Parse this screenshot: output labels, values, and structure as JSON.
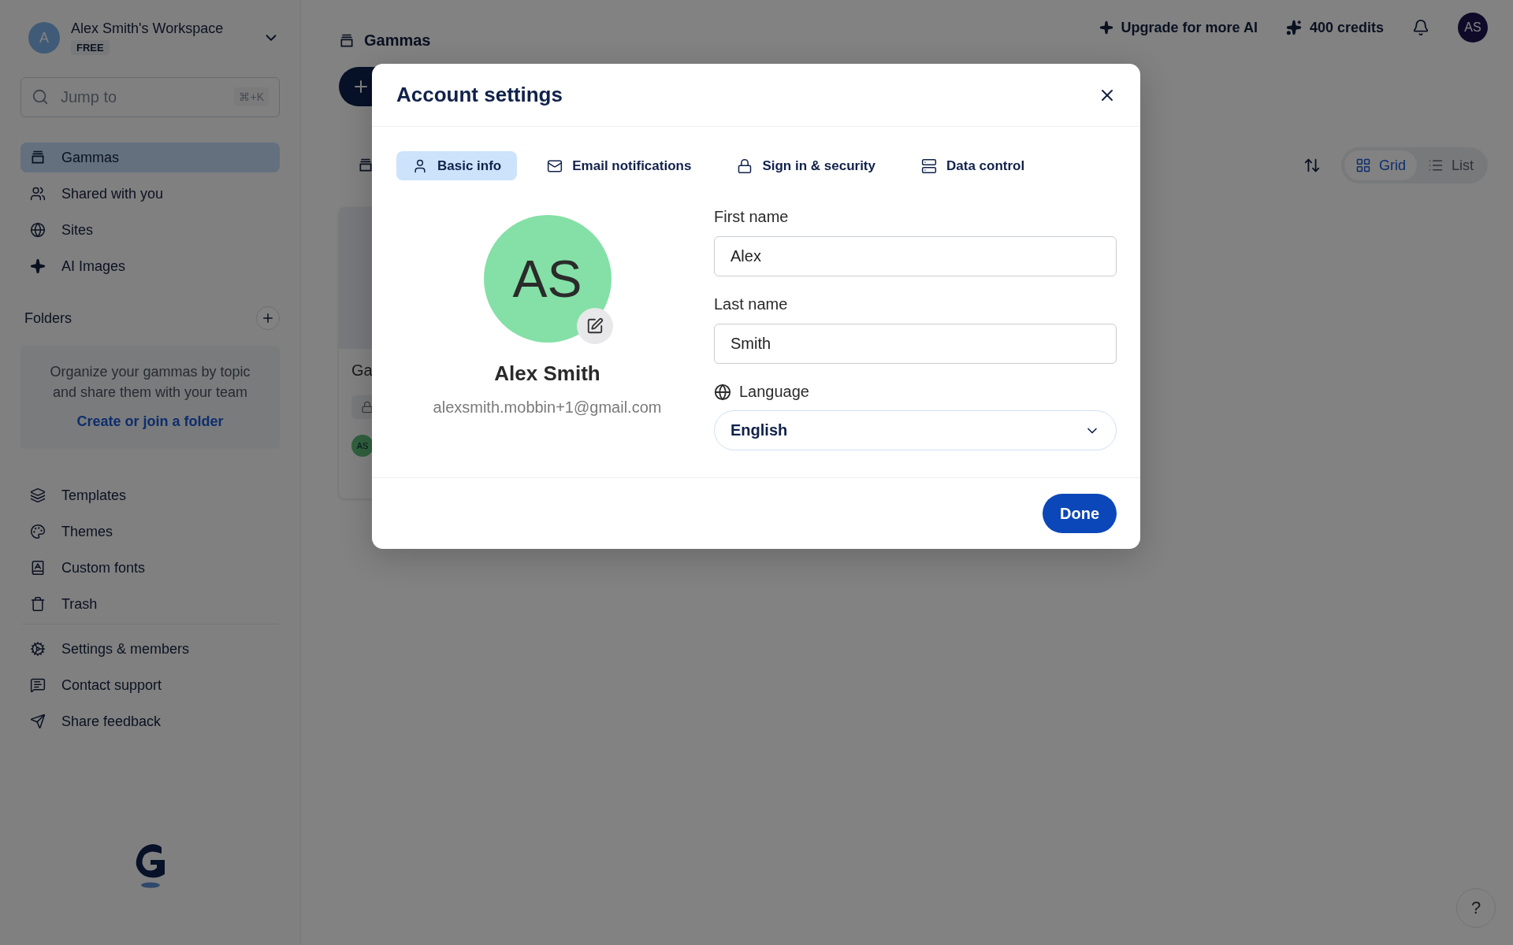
{
  "workspace": {
    "avatar": "A",
    "name": "Alex Smith's Workspace",
    "plan": "FREE"
  },
  "search": {
    "placeholder": "Jump to",
    "shortcut": "⌘+K"
  },
  "nav": [
    {
      "label": "Gammas",
      "selected": true
    },
    {
      "label": "Shared with you",
      "selected": false
    },
    {
      "label": "Sites",
      "selected": false
    },
    {
      "label": "AI Images",
      "selected": false
    }
  ],
  "folders": {
    "title": "Folders",
    "empty_text": "Organize your gammas by topic and share them with your team",
    "link": "Create or join a folder"
  },
  "tools": [
    {
      "label": "Templates"
    },
    {
      "label": "Themes"
    },
    {
      "label": "Custom fonts"
    },
    {
      "label": "Trash"
    }
  ],
  "support": [
    {
      "label": "Settings & members"
    },
    {
      "label": "Contact support"
    },
    {
      "label": "Share feedback"
    }
  ],
  "header": {
    "title": "Gammas",
    "upgrade": "Upgrade for more AI",
    "credits": "400 credits",
    "avatar": "AS"
  },
  "view_toggle": [
    {
      "label": "Grid",
      "selected": true
    },
    {
      "label": "List",
      "selected": false
    }
  ],
  "card": {
    "title": "Ga",
    "owner": "AS"
  },
  "dialog": {
    "title": "Account settings",
    "tabs": [
      {
        "label": "Basic info",
        "selected": true
      },
      {
        "label": "Email notifications",
        "selected": false
      },
      {
        "label": "Sign in & security",
        "selected": false
      },
      {
        "label": "Data control",
        "selected": false
      }
    ],
    "profile": {
      "initials": "AS",
      "name": "Alex Smith",
      "email": "alexsmith.mobbin+1@gmail.com"
    },
    "fields": [
      {
        "label": "First name",
        "value": "Alex"
      },
      {
        "label": "Last name",
        "value": "Smith"
      }
    ],
    "language": {
      "label": "Language",
      "value": "English"
    },
    "done": "Done"
  },
  "help": "?"
}
